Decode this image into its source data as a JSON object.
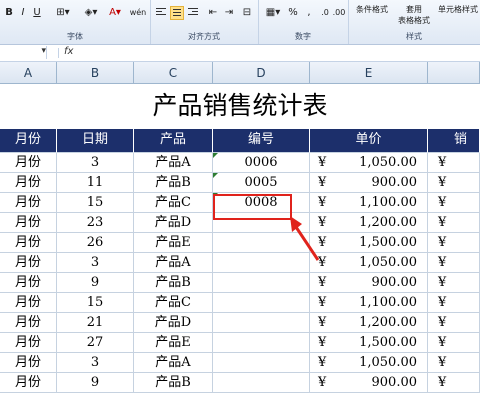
{
  "ribbon": {
    "groups": [
      {
        "label": "字体"
      },
      {
        "label": "对齐方式"
      },
      {
        "label": "数字"
      },
      {
        "label": "样式"
      }
    ],
    "style_buttons": {
      "conditional_format": "条件格式",
      "table_format_1": "套用",
      "table_format_2": "表格格式",
      "cell_styles": "单元格样式"
    },
    "number_symbols": {
      "percent": "%",
      "comma": ","
    },
    "font_tools": {
      "bold": "B",
      "italic": "I",
      "underline": "U",
      "grow_font": "wén"
    },
    "accent_color": "#ffe08a"
  },
  "formula_bar": {
    "fx_label": "fx",
    "name_box": "",
    "content": ""
  },
  "columns": [
    "A",
    "B",
    "C",
    "D",
    "E",
    ""
  ],
  "sheet": {
    "title": "产品销售统计表",
    "headers": [
      "月份",
      "日期",
      "产品",
      "编号",
      "单价",
      "销"
    ],
    "rows": [
      {
        "month": "月份",
        "day": "3",
        "product": "产品A",
        "code": "0006",
        "currency": "¥",
        "price": "1,050.00",
        "next": "¥"
      },
      {
        "month": "月份",
        "day": "11",
        "product": "产品B",
        "code": "0005",
        "currency": "¥",
        "price": "900.00",
        "next": "¥"
      },
      {
        "month": "月份",
        "day": "15",
        "product": "产品C",
        "code": "0008",
        "currency": "¥",
        "price": "1,100.00",
        "next": "¥"
      },
      {
        "month": "月份",
        "day": "23",
        "product": "产品D",
        "code": "",
        "currency": "¥",
        "price": "1,200.00",
        "next": "¥"
      },
      {
        "month": "月份",
        "day": "26",
        "product": "产品E",
        "code": "",
        "currency": "¥",
        "price": "1,500.00",
        "next": "¥"
      },
      {
        "month": "月份",
        "day": "3",
        "product": "产品A",
        "code": "",
        "currency": "¥",
        "price": "1,050.00",
        "next": "¥"
      },
      {
        "month": "月份",
        "day": "9",
        "product": "产品B",
        "code": "",
        "currency": "¥",
        "price": "900.00",
        "next": "¥"
      },
      {
        "month": "月份",
        "day": "15",
        "product": "产品C",
        "code": "",
        "currency": "¥",
        "price": "1,100.00",
        "next": "¥"
      },
      {
        "month": "月份",
        "day": "21",
        "product": "产品D",
        "code": "",
        "currency": "¥",
        "price": "1,200.00",
        "next": "¥"
      },
      {
        "month": "月份",
        "day": "27",
        "product": "产品E",
        "code": "",
        "currency": "¥",
        "price": "1,500.00",
        "next": "¥"
      },
      {
        "month": "月份",
        "day": "3",
        "product": "产品A",
        "code": "",
        "currency": "¥",
        "price": "1,050.00",
        "next": "¥"
      },
      {
        "month": "月份",
        "day": "9",
        "product": "产品B",
        "code": "",
        "currency": "¥",
        "price": "900.00",
        "next": "¥"
      }
    ],
    "header_color": "#1c2f6b",
    "highlight_color": "#e0231c"
  }
}
